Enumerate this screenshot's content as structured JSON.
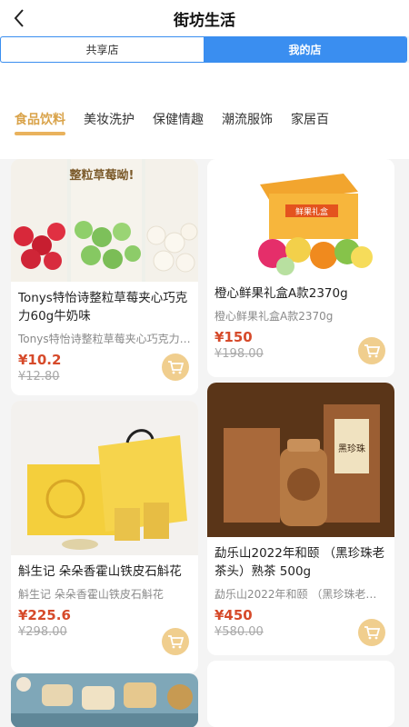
{
  "header": {
    "title": "街坊生活"
  },
  "segments": [
    {
      "label": "共享店",
      "active": false
    },
    {
      "label": "我的店",
      "active": true
    }
  ],
  "categories": [
    "食品饮料",
    "美妆洗护",
    "保健情趣",
    "潮流服饰",
    "家居百"
  ],
  "active_category": "食品饮料",
  "products": [
    {
      "name": "Tonys特怡诗整粒草莓夹心巧克力60g牛奶味",
      "sub": "Tonys特怡诗整粒草莓夹心巧克力60g牛奶味",
      "price": "¥10.2",
      "orig_price": "¥12.80",
      "pkg_text": "整粒草莓呦!"
    },
    {
      "name": "橙心鲜果礼盒A款2370g",
      "sub": "橙心鲜果礼盒A款2370g",
      "price": "¥150",
      "orig_price": "¥198.00",
      "pkg_text": "鲜果礼盒"
    },
    {
      "name": "斛生记 朵朵香霍山铁皮石斛花",
      "sub": "斛生记 朵朵香霍山铁皮石斛花",
      "price": "¥225.6",
      "orig_price": "¥298.00"
    },
    {
      "name": "勐乐山2022年和颐 （黑珍珠老茶头）熟茶 500g",
      "sub": "勐乐山2022年和颐 （黑珍珠老茶头）熟茶 500g",
      "price": "¥450",
      "orig_price": "¥580.00",
      "pkg_text": "黑珍珠"
    }
  ],
  "colors": {
    "accent": "#3a8ef0",
    "gold": "#e9b25d",
    "price": "#d64a2a"
  },
  "icons": {
    "back": "chevron-left-icon",
    "cart": "cart-icon"
  }
}
